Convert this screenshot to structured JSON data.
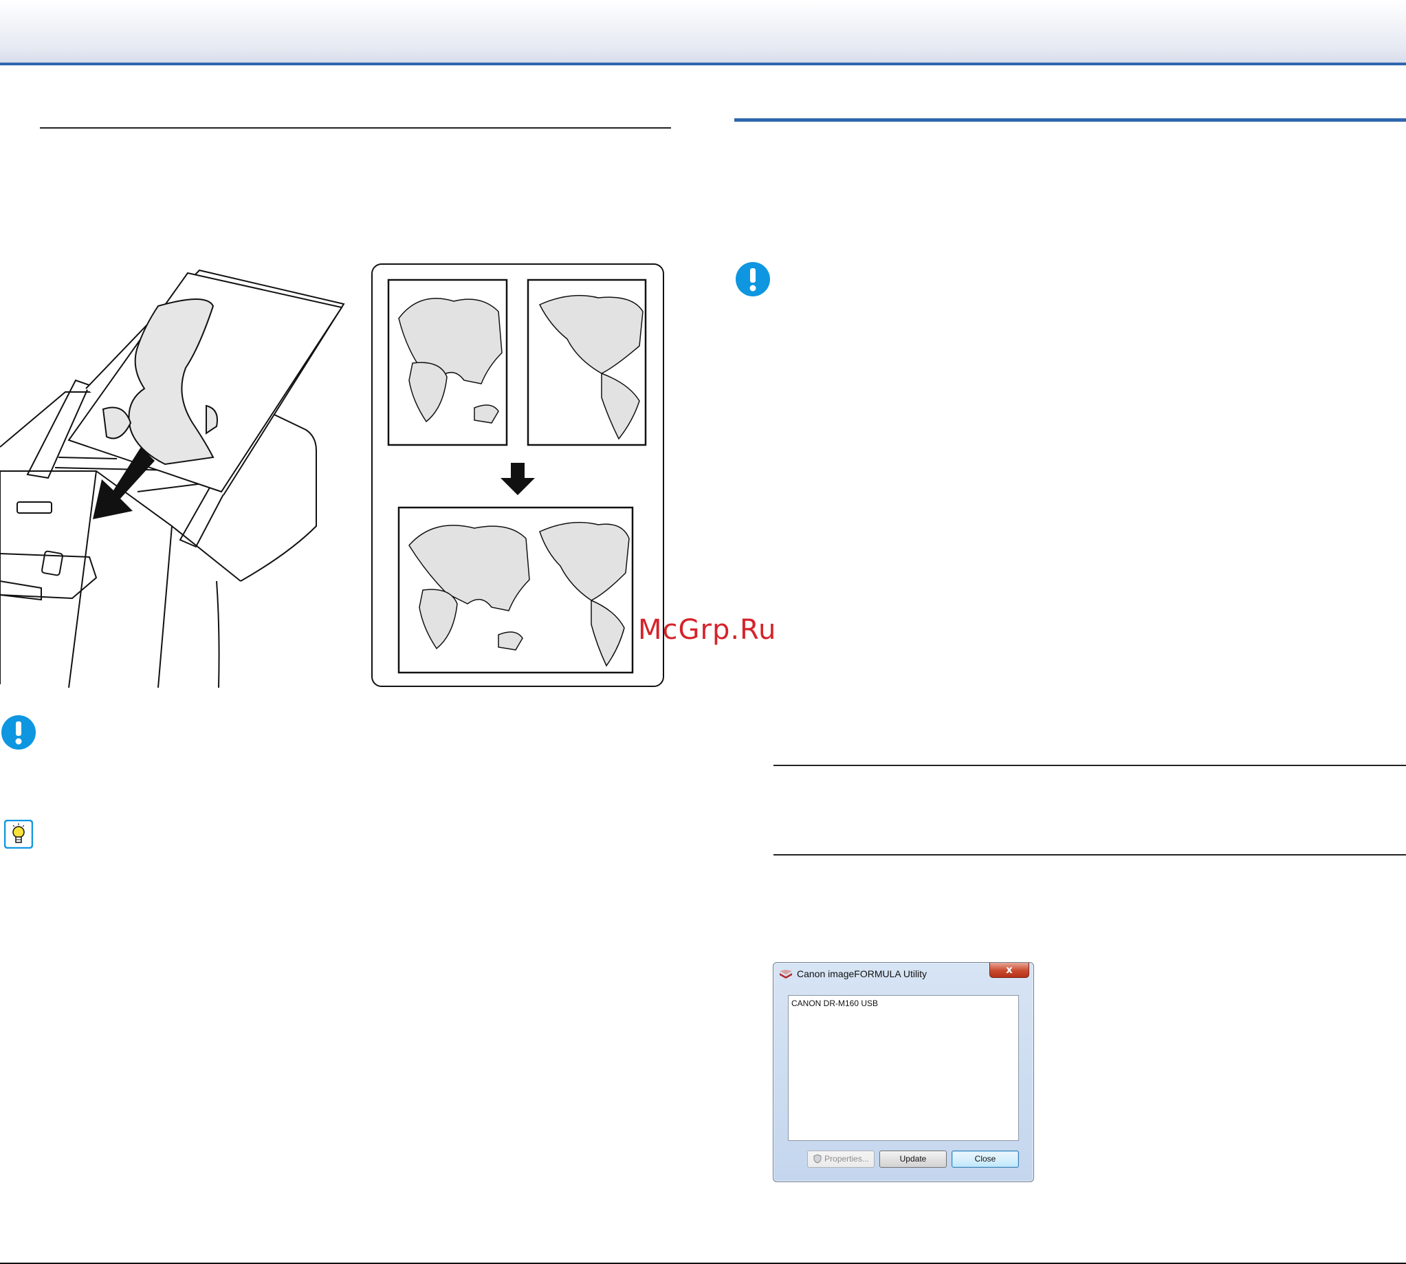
{
  "watermark": {
    "text": "McGrp.Ru"
  },
  "dialog": {
    "title": "Canon imageFORMULA Utility",
    "close_glyph": "x",
    "list_items": [
      "CANON DR-M160 USB"
    ],
    "buttons": {
      "properties": "Properties...",
      "update": "Update",
      "close": "Close"
    }
  },
  "icons": {
    "important": "important-icon",
    "hint": "hint-lightbulb-icon",
    "down_arrow": "down-arrow-icon"
  },
  "colors": {
    "accent_blue": "#2f66ae",
    "important_blue": "#0e96e0",
    "watermark_red": "#d5232a"
  }
}
